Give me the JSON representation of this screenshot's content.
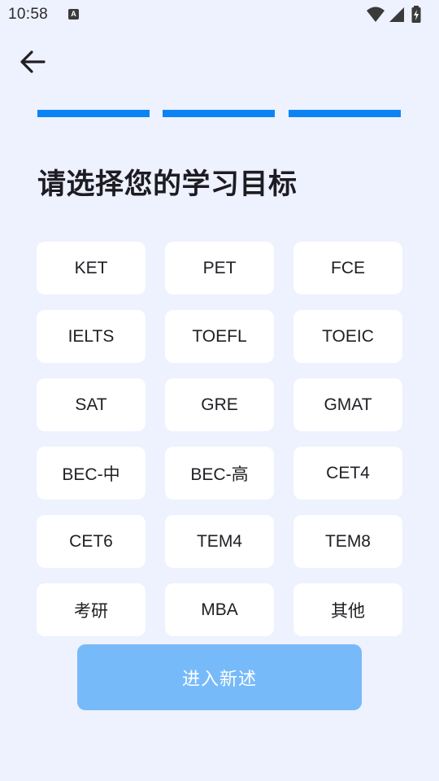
{
  "status_bar": {
    "time": "10:58",
    "notification_letter": "A",
    "icons": [
      "wifi-icon",
      "signal-icon",
      "battery-charging-icon"
    ]
  },
  "header": {
    "back_icon": "arrow-left-icon"
  },
  "progress": {
    "total_steps": 3,
    "completed_steps": 3,
    "color": "#0a84f5"
  },
  "title": "请选择您的学习目标",
  "options": [
    {
      "label": "KET"
    },
    {
      "label": "PET"
    },
    {
      "label": "FCE"
    },
    {
      "label": "IELTS"
    },
    {
      "label": "TOEFL"
    },
    {
      "label": "TOEIC"
    },
    {
      "label": "SAT"
    },
    {
      "label": "GRE"
    },
    {
      "label": "GMAT"
    },
    {
      "label": "BEC-中"
    },
    {
      "label": "BEC-高"
    },
    {
      "label": "CET4"
    },
    {
      "label": "CET6"
    },
    {
      "label": "TEM4"
    },
    {
      "label": "TEM8"
    },
    {
      "label": "考研"
    },
    {
      "label": "MBA"
    },
    {
      "label": "其他"
    }
  ],
  "submit": {
    "label": "进入新述",
    "color": "#77baf9",
    "enabled": false
  },
  "colors": {
    "background": "#eef1fe",
    "card": "#ffffff",
    "accent": "#0a84f5"
  }
}
